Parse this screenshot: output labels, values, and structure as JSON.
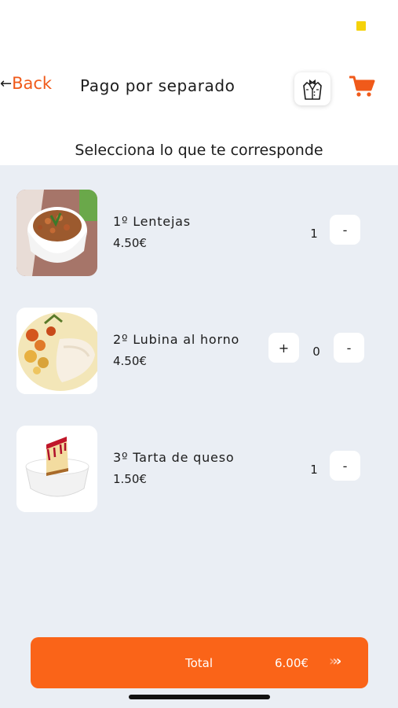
{
  "header": {
    "back_label": "Back",
    "title": "Pago por separado",
    "waiter_icon": "waiter-icon",
    "cart_icon": "cart-icon"
  },
  "subtitle": "Selecciona lo que te corresponde",
  "items": [
    {
      "name": "1º Lentejas",
      "price": "4.50€",
      "quantity": "1",
      "show_plus": false,
      "minus_label": "-",
      "image": "lentils-dish-image"
    },
    {
      "name": "2º Lubina al horno",
      "price": "4.50€",
      "quantity": "0",
      "show_plus": true,
      "plus_label": "+",
      "minus_label": "-",
      "image": "baked-sea-bass-image"
    },
    {
      "name": "3º Tarta de queso",
      "price": "1.50€",
      "quantity": "1",
      "show_plus": false,
      "minus_label": "-",
      "image": "cheesecake-image"
    }
  ],
  "footer": {
    "total_label": "Total",
    "total_amount": "6.00€",
    "proceed_icon": "triple-chevron-right-icon"
  },
  "colors": {
    "accent": "#fa6418",
    "back_link": "#f05a1a",
    "list_background": "#eaeef4",
    "status_indicator": "#f5d20a"
  }
}
